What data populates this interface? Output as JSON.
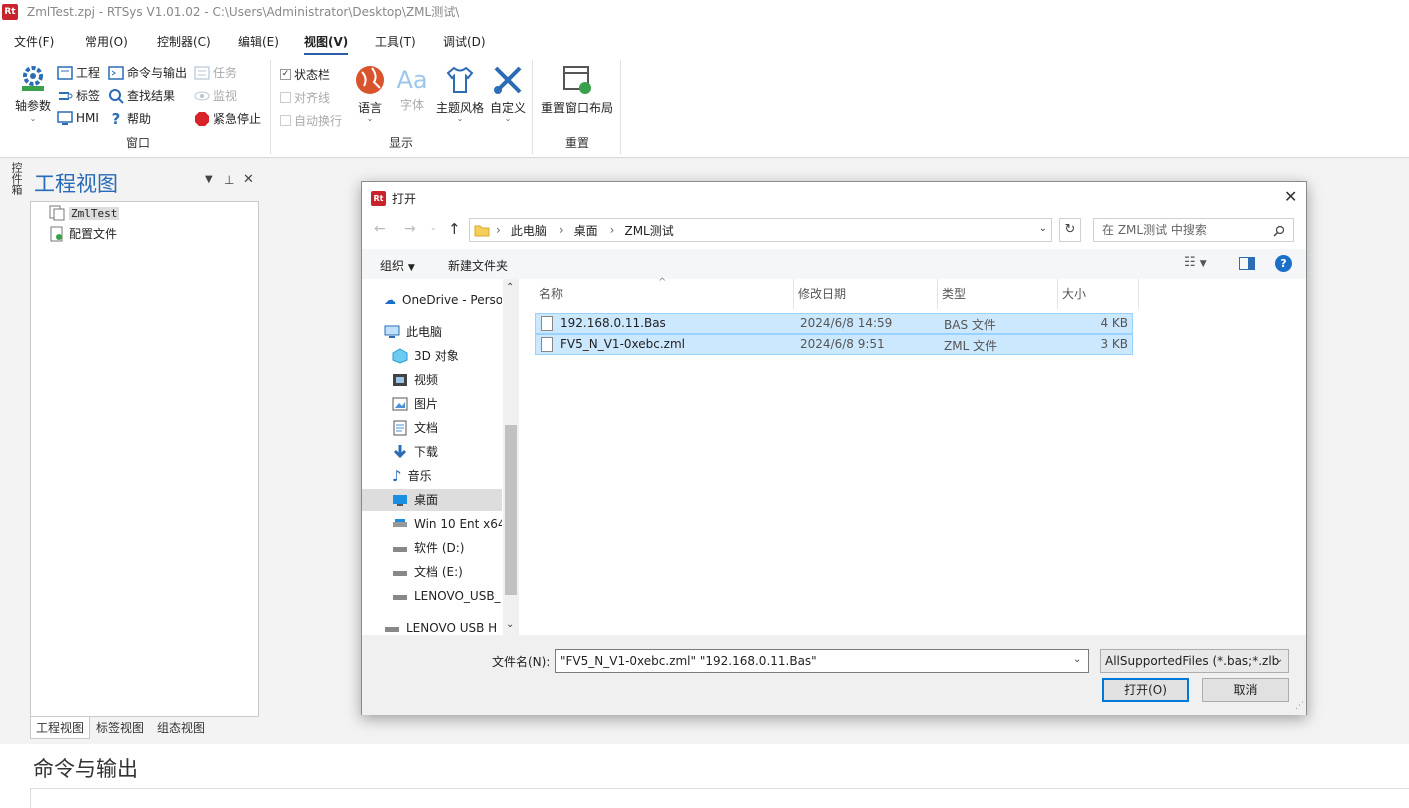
{
  "app": {
    "title": "ZmlTest.zpj - RTSys V1.01.02 - C:\\Users\\Administrator\\Desktop\\ZML测试\\",
    "logo_text": "Rt"
  },
  "menu": [
    "文件(F)",
    "常用(O)",
    "控制器(C)",
    "编辑(E)",
    "视图(V)",
    "工具(T)",
    "调试(D)"
  ],
  "ribbon": {
    "window_group": {
      "label": "窗口",
      "axis_params": "轴参数",
      "project": "工程",
      "labels": "标签",
      "hmi": "HMI",
      "cmd_output": "命令与输出",
      "find_results": "查找结果",
      "help": "帮助",
      "task": "任务",
      "monitor": "监视",
      "emergency_stop": "紧急停止"
    },
    "display_group": {
      "label": "显示",
      "status_bar": "状态栏",
      "align_line": "对齐线",
      "auto_wrap": "自动换行",
      "language": "语言",
      "font": "字体",
      "theme": "主题风格",
      "custom": "自定义"
    },
    "reset_group": {
      "label": "重置",
      "reset_layout": "重置窗口布局"
    }
  },
  "sidebar_tab": "控件箱",
  "project_view": {
    "title": "工程视图",
    "tree": [
      "ZmlTest",
      "配置文件"
    ],
    "tabs": [
      "工程视图",
      "标签视图",
      "组态视图"
    ]
  },
  "cmd_output": {
    "title": "命令与输出"
  },
  "dialog": {
    "logo_text": "Rt",
    "title": "打开",
    "address": [
      "此电脑",
      "桌面",
      "ZML测试"
    ],
    "search_placeholder": "在 ZML测试 中搜索",
    "organize": "组织",
    "new_folder": "新建文件夹",
    "nav": [
      {
        "label": "OneDrive - Perso",
        "icon": "cloud-icon"
      },
      {
        "label": "此电脑",
        "icon": "computer-icon"
      },
      {
        "label": "3D 对象",
        "icon": "cube-icon"
      },
      {
        "label": "视频",
        "icon": "video-icon"
      },
      {
        "label": "图片",
        "icon": "picture-icon"
      },
      {
        "label": "文档",
        "icon": "document-icon"
      },
      {
        "label": "下载",
        "icon": "download-icon"
      },
      {
        "label": "音乐",
        "icon": "music-icon"
      },
      {
        "label": "桌面",
        "icon": "desktop-icon"
      },
      {
        "label": "Win 10 Ent x64",
        "icon": "drive-icon"
      },
      {
        "label": "软件 (D:)",
        "icon": "drive-icon"
      },
      {
        "label": "文档 (E:)",
        "icon": "drive-icon"
      },
      {
        "label": "LENOVO_USB_",
        "icon": "drive-icon"
      },
      {
        "label": "LENOVO USB H",
        "icon": "usb-drive-icon"
      }
    ],
    "columns": [
      "名称",
      "修改日期",
      "类型",
      "大小"
    ],
    "files": [
      {
        "name": "192.168.0.11.Bas",
        "date": "2024/6/8 14:59",
        "type": "BAS 文件",
        "size": "4 KB"
      },
      {
        "name": "FV5_N_V1-0xebc.zml",
        "date": "2024/6/8 9:51",
        "type": "ZML 文件",
        "size": "3 KB"
      }
    ],
    "filename_label": "文件名(N):",
    "filename_value": "\"FV5_N_V1-0xebc.zml\" \"192.168.0.11.Bas\"",
    "filter": "AllSupportedFiles (*.bas;*.zlb",
    "open_button": "打开(O)",
    "cancel_button": "取消"
  }
}
